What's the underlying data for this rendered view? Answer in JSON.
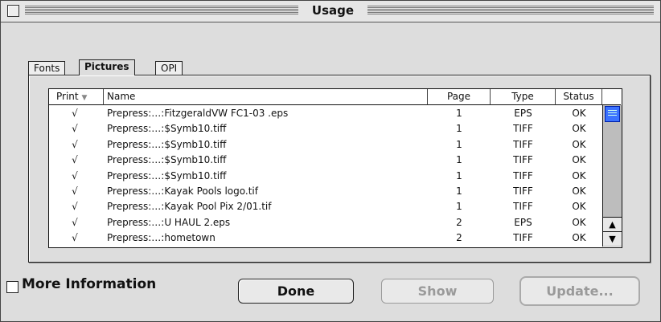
{
  "window": {
    "title": "Usage"
  },
  "tabs": [
    {
      "label": "Fonts",
      "active": false
    },
    {
      "label": "Pictures",
      "active": true
    },
    {
      "label": "OPI",
      "active": false
    }
  ],
  "table": {
    "columns": [
      "Print",
      "Name",
      "Page",
      "Type",
      "Status"
    ],
    "sort_column": "Print",
    "rows": [
      {
        "print": "√",
        "name": "Prepress:…:FitzgeraldVW FC1-03 .eps",
        "page": "1",
        "type": "EPS",
        "status": "OK"
      },
      {
        "print": "√",
        "name": "Prepress:…:$Symb10.tiff",
        "page": "1",
        "type": "TIFF",
        "status": "OK"
      },
      {
        "print": "√",
        "name": "Prepress:…:$Symb10.tiff",
        "page": "1",
        "type": "TIFF",
        "status": "OK"
      },
      {
        "print": "√",
        "name": "Prepress:…:$Symb10.tiff",
        "page": "1",
        "type": "TIFF",
        "status": "OK"
      },
      {
        "print": "√",
        "name": "Prepress:…:$Symb10.tiff",
        "page": "1",
        "type": "TIFF",
        "status": "OK"
      },
      {
        "print": "√",
        "name": "Prepress:…:Kayak Pools logo.tif",
        "page": "1",
        "type": "TIFF",
        "status": "OK"
      },
      {
        "print": "√",
        "name": "Prepress:…:Kayak Pool Pix 2/01.tif",
        "page": "1",
        "type": "TIFF",
        "status": "OK"
      },
      {
        "print": "√",
        "name": "Prepress:…:U HAUL 2.eps",
        "page": "2",
        "type": "EPS",
        "status": "OK"
      },
      {
        "print": "√",
        "name": "Prepress:…:hometown",
        "page": "2",
        "type": "TIFF",
        "status": "OK"
      }
    ]
  },
  "options": {
    "more_information_label": "More Information",
    "more_information_checked": false
  },
  "buttons": {
    "done": "Done",
    "show": "Show",
    "update": "Update..."
  },
  "colors": {
    "scroll_thumb": "#3b72ff",
    "window_bg": "#dddddd"
  }
}
